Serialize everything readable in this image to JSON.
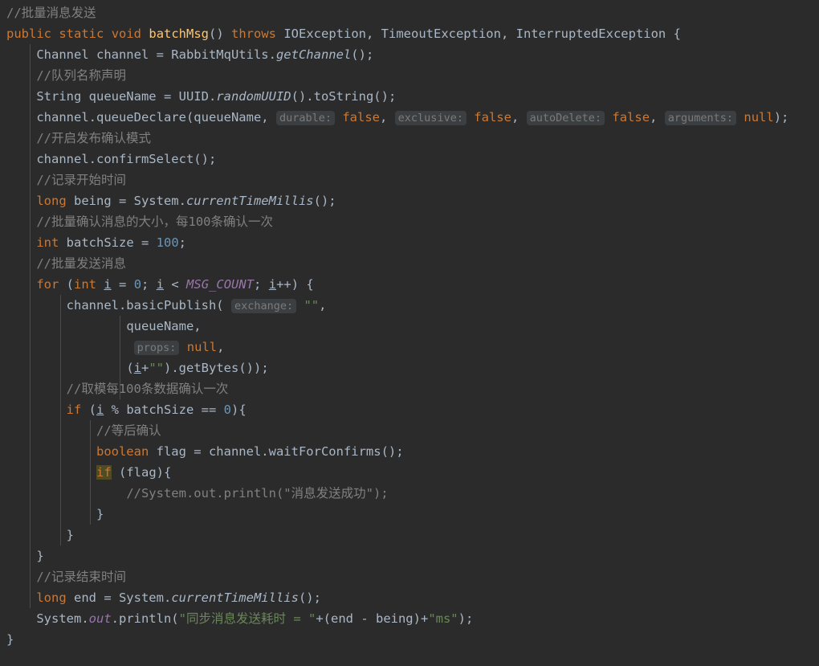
{
  "editor": {
    "language": "java",
    "theme": "darcula",
    "background_color": "#2b2b2b",
    "default_text_color": "#a9b7c6",
    "colors": {
      "comment": "#808080",
      "keyword": "#cc7832",
      "string": "#6a8759",
      "number": "#6897bb",
      "method_declaration": "#ffc66d",
      "static_member": "#9876aa",
      "inlay_hint_text": "#7a7a7a",
      "inlay_hint_background": "#3c3f41",
      "identifier_highlight_background": "#4f4b23",
      "indent_guide": "#4b4b4b"
    }
  },
  "code": {
    "lines": [
      {
        "indent": 0,
        "tokens": [
          {
            "t": "//批量消息发送",
            "c": "cmt"
          }
        ]
      },
      {
        "indent": 0,
        "tokens": [
          {
            "t": "public",
            "c": "kw"
          },
          {
            "t": " ",
            "c": "txt"
          },
          {
            "t": "static",
            "c": "kw"
          },
          {
            "t": " ",
            "c": "txt"
          },
          {
            "t": "void",
            "c": "kw"
          },
          {
            "t": " ",
            "c": "txt"
          },
          {
            "t": "batchMsg",
            "c": "mth"
          },
          {
            "t": "() ",
            "c": "txt"
          },
          {
            "t": "throws",
            "c": "kw"
          },
          {
            "t": " IOException, TimeoutException, InterruptedException {",
            "c": "txt"
          }
        ]
      },
      {
        "indent": 1,
        "tokens": [
          {
            "t": "Channel channel = RabbitMqUtils.",
            "c": "txt"
          },
          {
            "t": "getChannel",
            "c": "sm"
          },
          {
            "t": "();",
            "c": "txt"
          }
        ]
      },
      {
        "indent": 1,
        "tokens": [
          {
            "t": "//队列名称声明",
            "c": "cmt"
          }
        ]
      },
      {
        "indent": 1,
        "tokens": [
          {
            "t": "String queueName = UUID.",
            "c": "txt"
          },
          {
            "t": "randomUUID",
            "c": "sm"
          },
          {
            "t": "().toString();",
            "c": "txt"
          }
        ]
      },
      {
        "indent": 1,
        "tokens": [
          {
            "t": "channel.queueDeclare(queueName, ",
            "c": "txt"
          },
          {
            "t": "durable:",
            "c": "hint"
          },
          {
            "t": " ",
            "c": "txt"
          },
          {
            "t": "false",
            "c": "kw"
          },
          {
            "t": ", ",
            "c": "txt"
          },
          {
            "t": "exclusive:",
            "c": "hint"
          },
          {
            "t": " ",
            "c": "txt"
          },
          {
            "t": "false",
            "c": "kw"
          },
          {
            "t": ", ",
            "c": "txt"
          },
          {
            "t": "autoDelete:",
            "c": "hint"
          },
          {
            "t": " ",
            "c": "txt"
          },
          {
            "t": "false",
            "c": "kw"
          },
          {
            "t": ", ",
            "c": "txt"
          },
          {
            "t": "arguments:",
            "c": "hint"
          },
          {
            "t": " ",
            "c": "txt"
          },
          {
            "t": "null",
            "c": "kw"
          },
          {
            "t": ");",
            "c": "txt"
          }
        ]
      },
      {
        "indent": 1,
        "tokens": [
          {
            "t": "//开启发布确认模式",
            "c": "cmt"
          }
        ]
      },
      {
        "indent": 1,
        "tokens": [
          {
            "t": "channel.confirmSelect();",
            "c": "txt"
          }
        ]
      },
      {
        "indent": 1,
        "tokens": [
          {
            "t": "//记录开始时间",
            "c": "cmt"
          }
        ]
      },
      {
        "indent": 1,
        "tokens": [
          {
            "t": "long",
            "c": "kw"
          },
          {
            "t": " being = System.",
            "c": "txt"
          },
          {
            "t": "currentTimeMillis",
            "c": "sm"
          },
          {
            "t": "();",
            "c": "txt"
          }
        ]
      },
      {
        "indent": 1,
        "tokens": [
          {
            "t": "//批量确认消息的大小，每100条确认一次",
            "c": "cmt"
          }
        ]
      },
      {
        "indent": 1,
        "tokens": [
          {
            "t": "int",
            "c": "kw"
          },
          {
            "t": " batchSize = ",
            "c": "txt"
          },
          {
            "t": "100",
            "c": "num"
          },
          {
            "t": ";",
            "c": "txt"
          }
        ]
      },
      {
        "indent": 1,
        "tokens": [
          {
            "t": "//批量发送消息",
            "c": "cmt"
          }
        ]
      },
      {
        "indent": 1,
        "tokens": [
          {
            "t": "for",
            "c": "kw"
          },
          {
            "t": " (",
            "c": "txt"
          },
          {
            "t": "int",
            "c": "kw"
          },
          {
            "t": " ",
            "c": "txt"
          },
          {
            "t": "i",
            "c": "var"
          },
          {
            "t": " = ",
            "c": "txt"
          },
          {
            "t": "0",
            "c": "num"
          },
          {
            "t": "; ",
            "c": "txt"
          },
          {
            "t": "i",
            "c": "var"
          },
          {
            "t": " < ",
            "c": "txt"
          },
          {
            "t": "MSG_COUNT",
            "c": "stat"
          },
          {
            "t": "; ",
            "c": "txt"
          },
          {
            "t": "i",
            "c": "var"
          },
          {
            "t": "++) {",
            "c": "txt"
          }
        ]
      },
      {
        "indent": 2,
        "tokens": [
          {
            "t": "channel.basicPublish( ",
            "c": "txt"
          },
          {
            "t": "exchange:",
            "c": "hint"
          },
          {
            "t": " ",
            "c": "txt"
          },
          {
            "t": "\"\"",
            "c": "str"
          },
          {
            "t": ",",
            "c": "txt"
          }
        ]
      },
      {
        "indent": 4,
        "tokens": [
          {
            "t": "queueName,",
            "c": "txt"
          }
        ]
      },
      {
        "indent": 4,
        "tokens": [
          {
            "t": " ",
            "c": "txt"
          },
          {
            "t": "props:",
            "c": "hint"
          },
          {
            "t": " ",
            "c": "txt"
          },
          {
            "t": "null",
            "c": "kw"
          },
          {
            "t": ",",
            "c": "txt"
          }
        ]
      },
      {
        "indent": 4,
        "tokens": [
          {
            "t": "(",
            "c": "txt"
          },
          {
            "t": "i",
            "c": "var"
          },
          {
            "t": "+",
            "c": "txt"
          },
          {
            "t": "\"\"",
            "c": "str"
          },
          {
            "t": ").getBytes());",
            "c": "txt"
          }
        ]
      },
      {
        "indent": 2,
        "tokens": [
          {
            "t": "//取模每100条数据确认一次",
            "c": "cmt"
          }
        ]
      },
      {
        "indent": 2,
        "tokens": [
          {
            "t": "if",
            "c": "kw"
          },
          {
            "t": " (",
            "c": "txt"
          },
          {
            "t": "i",
            "c": "var"
          },
          {
            "t": " % batchSize == ",
            "c": "txt"
          },
          {
            "t": "0",
            "c": "num"
          },
          {
            "t": "){",
            "c": "txt"
          }
        ]
      },
      {
        "indent": 3,
        "tokens": [
          {
            "t": "//等后确认",
            "c": "cmt"
          }
        ]
      },
      {
        "indent": 3,
        "tokens": [
          {
            "t": "boolean",
            "c": "kw"
          },
          {
            "t": " flag = channel.waitForConfirms();",
            "c": "txt"
          }
        ]
      },
      {
        "indent": 3,
        "tokens": [
          {
            "t": "if",
            "c": "hl"
          },
          {
            "t": " (flag){",
            "c": "txt"
          }
        ]
      },
      {
        "indent": 4,
        "tokens": [
          {
            "t": "//System.out.println(\"消息发送成功\");",
            "c": "cmt"
          }
        ]
      },
      {
        "indent": 3,
        "tokens": [
          {
            "t": "}",
            "c": "txt"
          }
        ]
      },
      {
        "indent": 2,
        "tokens": [
          {
            "t": "}",
            "c": "txt"
          }
        ]
      },
      {
        "indent": 1,
        "tokens": [
          {
            "t": "}",
            "c": "txt"
          }
        ]
      },
      {
        "indent": 1,
        "tokens": [
          {
            "t": "//记录结束时间",
            "c": "cmt"
          }
        ]
      },
      {
        "indent": 1,
        "tokens": [
          {
            "t": "long",
            "c": "kw"
          },
          {
            "t": " end = System.",
            "c": "txt"
          },
          {
            "t": "currentTimeMillis",
            "c": "sm"
          },
          {
            "t": "();",
            "c": "txt"
          }
        ]
      },
      {
        "indent": 1,
        "tokens": [
          {
            "t": "System.",
            "c": "txt"
          },
          {
            "t": "out",
            "c": "stat"
          },
          {
            "t": ".println(",
            "c": "txt"
          },
          {
            "t": "\"同步消息发送耗时 = \"",
            "c": "str"
          },
          {
            "t": "+(end - being)+",
            "c": "txt"
          },
          {
            "t": "\"ms\"",
            "c": "str"
          },
          {
            "t": ");",
            "c": "txt"
          }
        ]
      },
      {
        "indent": 0,
        "tokens": [
          {
            "t": "}",
            "c": "txt"
          }
        ]
      }
    ]
  },
  "indent_guides": [
    {
      "level": 1,
      "from_line": 2,
      "to_line": 28
    },
    {
      "level": 2,
      "from_line": 14,
      "to_line": 25
    },
    {
      "level": 3,
      "from_line": 20,
      "to_line": 24
    },
    {
      "level": 4,
      "from_line": 15,
      "to_line": 18
    }
  ]
}
